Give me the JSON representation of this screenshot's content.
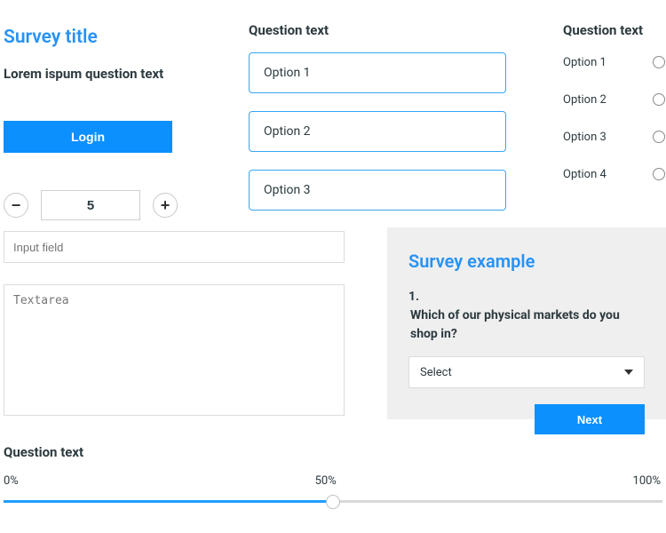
{
  "left": {
    "survey_title": "Survey title",
    "question_text": "Lorem ispum question text",
    "login_label": "Login",
    "stepper_value": "5"
  },
  "mid": {
    "heading": "Question text",
    "options": [
      "Option 1",
      "Option 2",
      "Option 3"
    ]
  },
  "right": {
    "heading": "Question text",
    "options": [
      "Option 1",
      "Option 2",
      "Option 3",
      "Option 4"
    ]
  },
  "input_placeholder": "Input field",
  "textarea_placeholder": "Textarea",
  "panel": {
    "title": "Survey example",
    "qnum": "1.",
    "question": "Which of our physical markets do you shop in?",
    "select_label": "Select",
    "next_label": "Next"
  },
  "slider": {
    "heading": "Question text",
    "labels": [
      "0%",
      "50%",
      "100%"
    ],
    "value_percent": 50
  },
  "colors": {
    "accent": "#0b90fe",
    "link_blue": "#2692f6"
  }
}
